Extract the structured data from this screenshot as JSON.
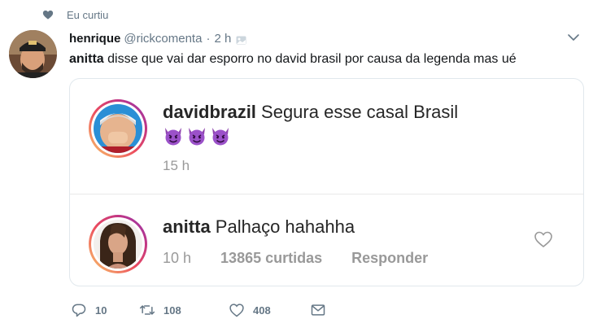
{
  "social_context": {
    "text": "Eu curtiu",
    "icon": "heart-icon"
  },
  "tweet": {
    "author_name": "henrique",
    "author_handle": "@rickcomenta",
    "separator": "·",
    "time": "2 h",
    "text_bold": "anitta",
    "text_rest": " disse que vai dar esporro no david brasil por causa da legenda mas ué"
  },
  "embedded": {
    "comment1": {
      "username": "davidbrazil",
      "text": " Segura esse casal Brasil",
      "emojis": [
        "smiling-imp-emoji",
        "smiling-imp-emoji",
        "smiling-imp-emoji"
      ],
      "time": "15 h"
    },
    "comment2": {
      "username": "anitta",
      "text": " Palhaço hahahha",
      "time": "10 h",
      "likes": "13865 curtidas",
      "reply": "Responder"
    }
  },
  "actions": {
    "replies": "10",
    "retweets": "108",
    "likes": "408"
  },
  "colors": {
    "muted": "#657786",
    "text": "#14171a",
    "border": "#e1e8ed",
    "ig_gray": "#999999",
    "emoji": "#8e44ad"
  }
}
